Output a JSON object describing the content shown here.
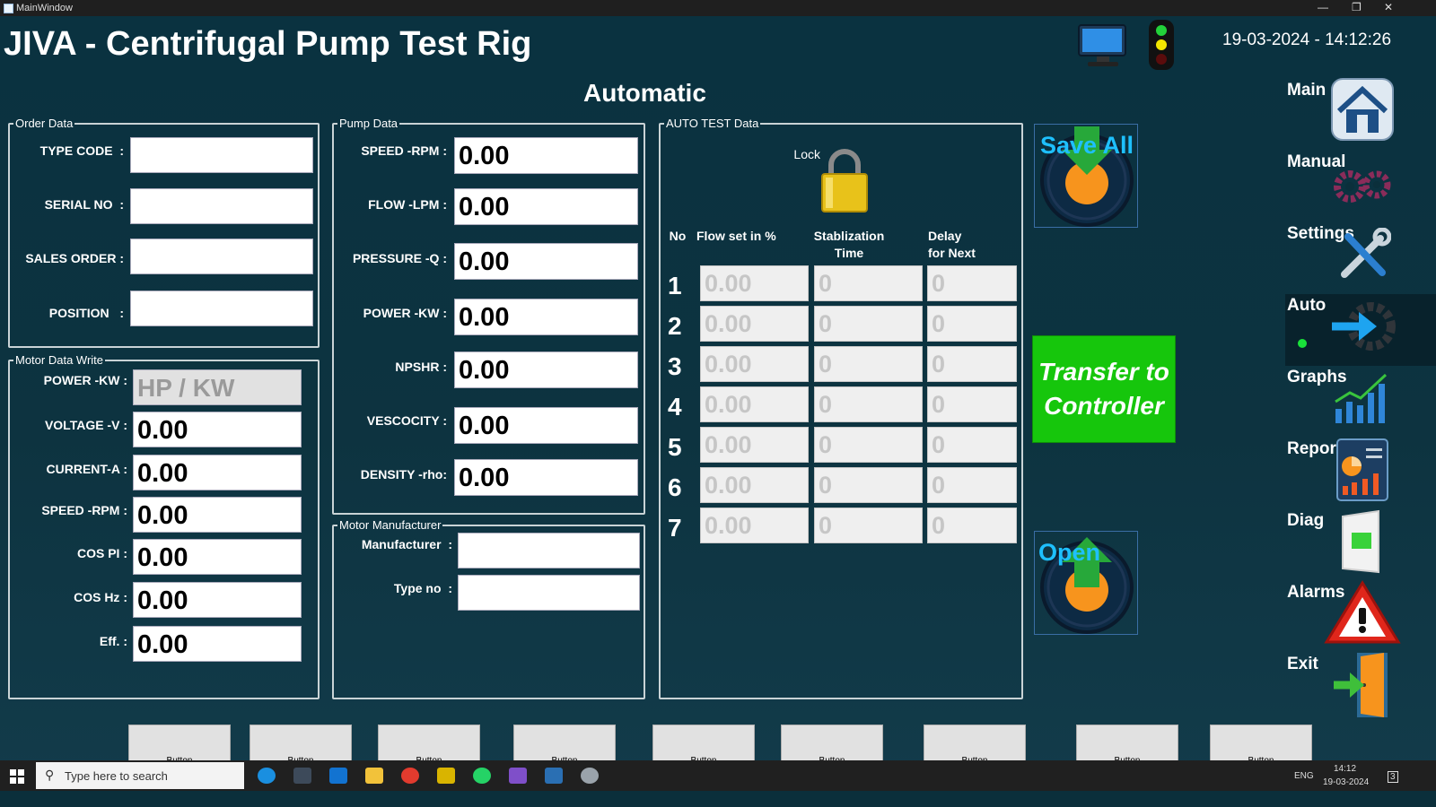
{
  "window": {
    "title": "MainWindow"
  },
  "app": {
    "title": "JIVA - Centrifugal Pump Test Rig",
    "datetime": "19-03-2024 - 14:12:26",
    "mode": "Automatic"
  },
  "order_data": {
    "legend": "Order Data",
    "fields": [
      {
        "label": "TYPE CODE",
        "value": ""
      },
      {
        "label": "SERIAL NO",
        "value": ""
      },
      {
        "label": "SALES ORDER",
        "value": ""
      },
      {
        "label": "POSITION",
        "value": ""
      }
    ]
  },
  "motor_data": {
    "legend": "Motor Data Write",
    "fields": [
      {
        "label": "POWER -KW",
        "value": "HP  / KW"
      },
      {
        "label": "VOLTAGE -V",
        "value": "0.00"
      },
      {
        "label": "CURRENT-A",
        "value": "0.00"
      },
      {
        "label": "SPEED -RPM",
        "value": "0.00"
      },
      {
        "label": "COS PI",
        "value": "0.00"
      },
      {
        "label": "COS Hz",
        "value": "0.00"
      },
      {
        "label": "Eff.",
        "value": "0.00"
      }
    ]
  },
  "pump_data": {
    "legend": "Pump Data",
    "fields": [
      {
        "label": "SPEED -RPM",
        "value": "0.00"
      },
      {
        "label": "FLOW -LPM",
        "value": "0.00"
      },
      {
        "label": "PRESSURE -Q",
        "value": "0.00"
      },
      {
        "label": "POWER -KW",
        "value": "0.00"
      },
      {
        "label": "NPSHR",
        "value": "0.00"
      },
      {
        "label": "VESCOCITY",
        "value": "0.00"
      },
      {
        "label": "DENSITY -rho",
        "value": "0.00"
      }
    ]
  },
  "motor_manufacturer": {
    "legend": "Motor Manufacturer",
    "fields": [
      {
        "label": "Manufacturer",
        "value": ""
      },
      {
        "label": "Type no",
        "value": ""
      }
    ]
  },
  "auto_test": {
    "legend": "AUTO TEST Data",
    "lock_label": "Lock",
    "headers": {
      "no": "No",
      "flow": "Flow set in %",
      "stab": "Stablization\nTime",
      "delay": "Delay\nfor Next"
    },
    "rows": [
      {
        "no": "1",
        "flow": "0.00",
        "stab": "0",
        "delay": "0"
      },
      {
        "no": "2",
        "flow": "0.00",
        "stab": "0",
        "delay": "0"
      },
      {
        "no": "3",
        "flow": "0.00",
        "stab": "0",
        "delay": "0"
      },
      {
        "no": "4",
        "flow": "0.00",
        "stab": "0",
        "delay": "0"
      },
      {
        "no": "5",
        "flow": "0.00",
        "stab": "0",
        "delay": "0"
      },
      {
        "no": "6",
        "flow": "0.00",
        "stab": "0",
        "delay": "0"
      },
      {
        "no": "7",
        "flow": "0.00",
        "stab": "0",
        "delay": "0"
      }
    ]
  },
  "actions": {
    "save_all": "Save All",
    "transfer": "Transfer to\nController",
    "open": "Open"
  },
  "nav": [
    "Main",
    "Manual",
    "Settings",
    "Auto",
    "Graphs",
    "Reports",
    "Diag",
    "Alarms",
    "Exit"
  ],
  "bottom_buttons": [
    "Button",
    "Button",
    "Button",
    "Button",
    "Button",
    "Button",
    "Button",
    "Button",
    "Button"
  ],
  "taskbar": {
    "search_placeholder": "Type here to search",
    "lang": "ENG",
    "time": "14:12",
    "date": "19-03-2024",
    "notif_count": "3"
  },
  "colors": {
    "background": "#0b2f3b",
    "transfer_green": "#16c60c",
    "save_blue": "#1e90ff",
    "accent_orange": "#f7941d"
  },
  "icons": [
    "computer-icon",
    "traffic-light-icon",
    "lock-icon",
    "home-icon",
    "gears-icon",
    "tools-icon",
    "arrow-gear-icon",
    "bar-graph-icon",
    "report-icon",
    "diag-switch-icon",
    "alarm-warning-icon",
    "exit-door-icon"
  ]
}
